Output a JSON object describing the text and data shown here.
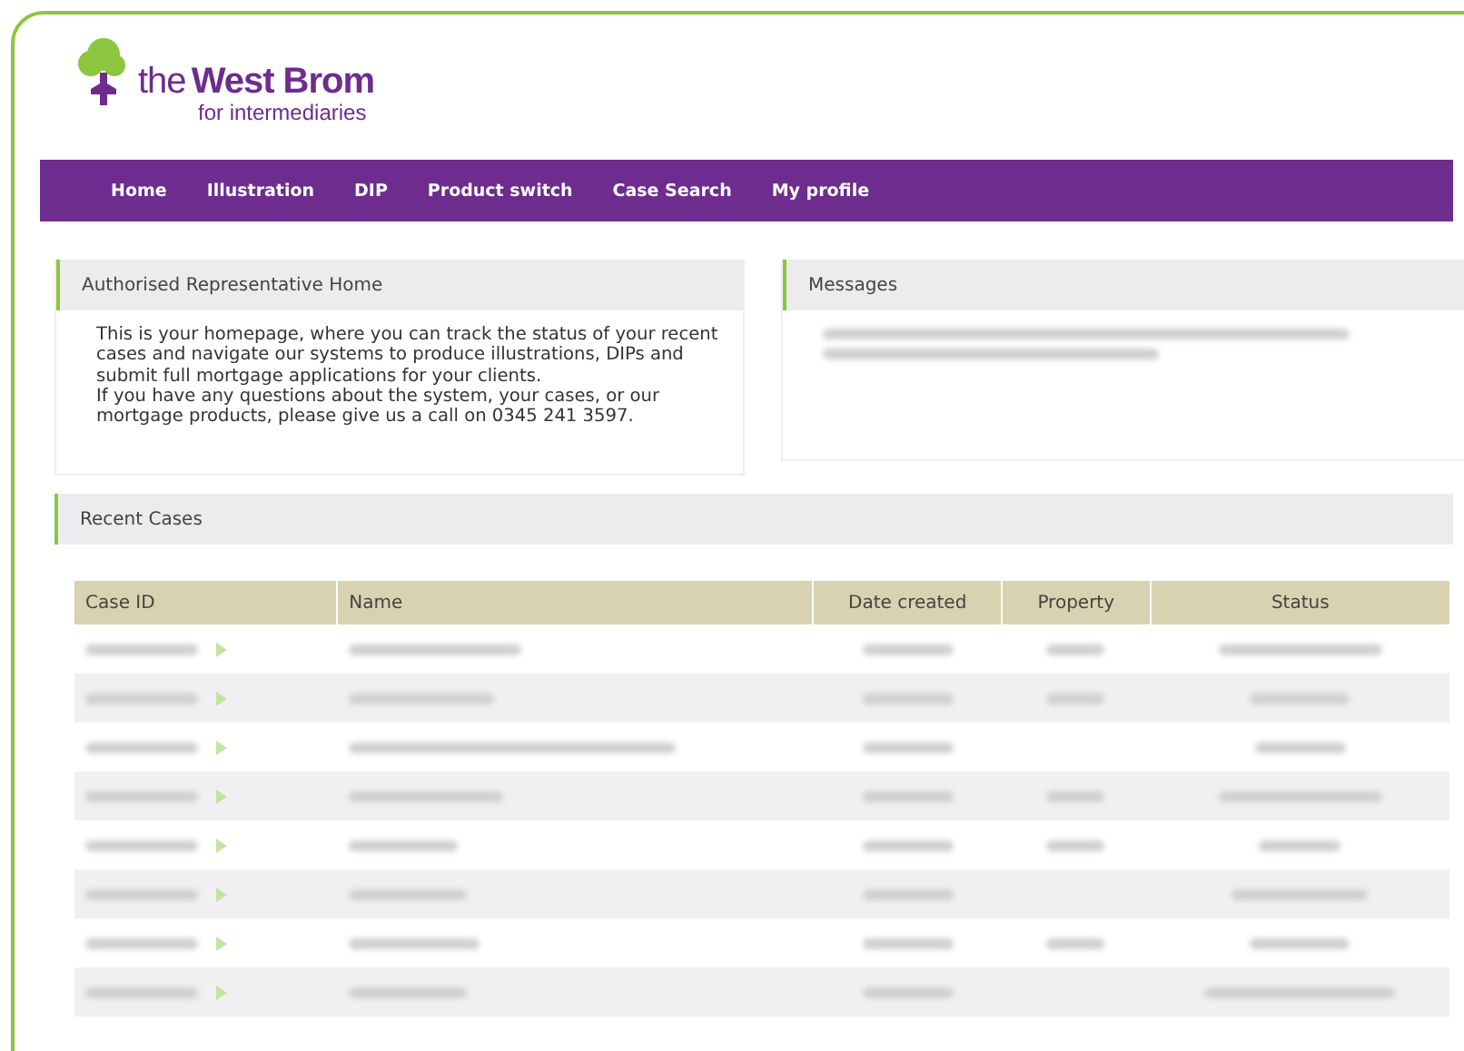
{
  "logo": {
    "prefix": "the",
    "name": "West Brom",
    "tagline": "for intermediaries"
  },
  "nav": [
    {
      "label": "Home"
    },
    {
      "label": "Illustration"
    },
    {
      "label": "DIP"
    },
    {
      "label": "Product switch"
    },
    {
      "label": "Case Search"
    },
    {
      "label": "My profile"
    }
  ],
  "home_panel": {
    "title": "Authorised Representative Home",
    "paragraphs": [
      "This is your homepage, where you can track the status of your recent cases and navigate our systems to produce illustrations, DIPs and submit full mortgage applications for your clients.",
      "If you have any questions about the system, your cases, or our mortgage products, please give us a call on 0345 241 3597."
    ]
  },
  "messages_panel": {
    "title": "Messages",
    "redacted_lines": [
      {
        "kind": "long"
      },
      {
        "kind": "short"
      }
    ]
  },
  "recent_cases": {
    "title": "Recent Cases",
    "columns": [
      "Case ID",
      "Name",
      "Date created",
      "Property",
      "Status"
    ],
    "rows": [
      {
        "property_shown": true
      },
      {
        "property_shown": true
      },
      {
        "property_shown": false
      },
      {
        "property_shown": true
      },
      {
        "property_shown": true
      },
      {
        "property_shown": false
      },
      {
        "property_shown": true
      },
      {
        "property_shown": false
      }
    ]
  }
}
